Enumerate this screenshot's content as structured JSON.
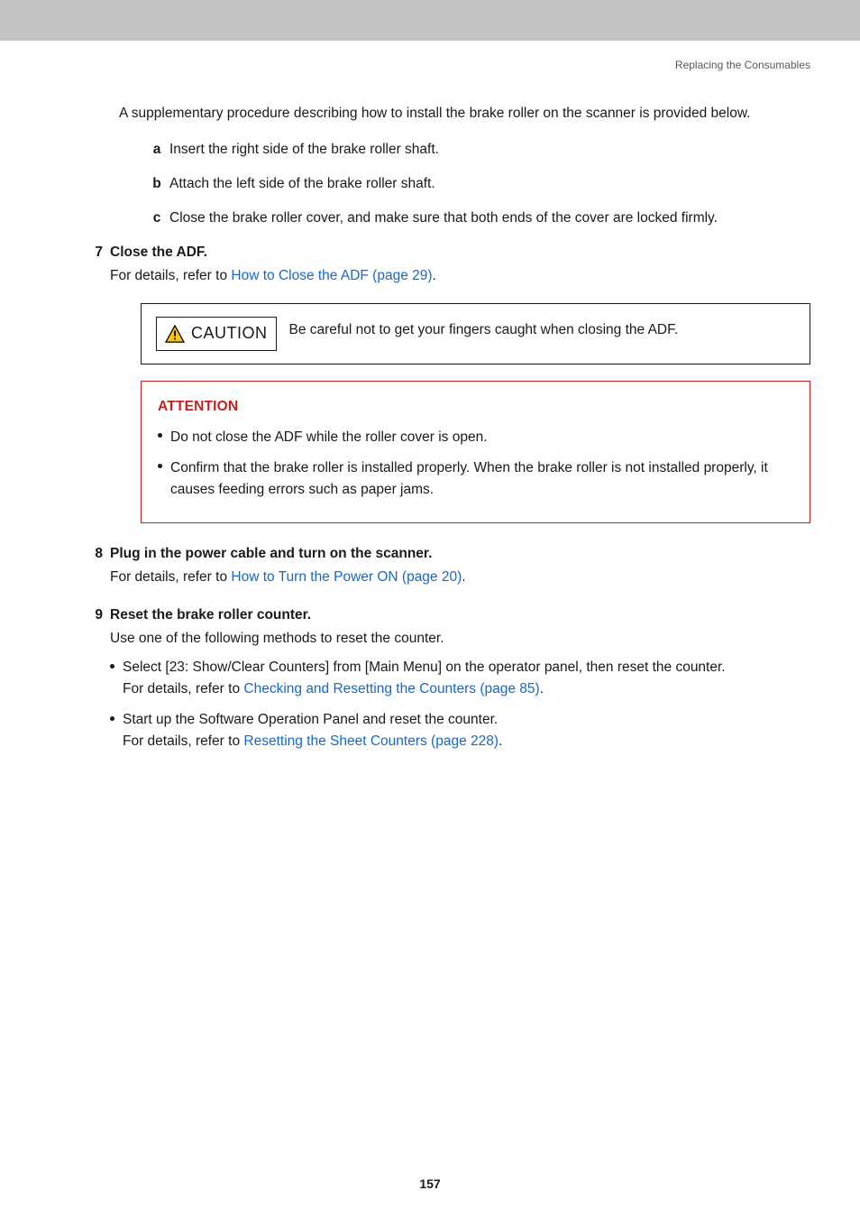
{
  "running_head": "Replacing the Consumables",
  "intro": "A supplementary procedure describing how to install the brake roller on the scanner is provided below.",
  "sub": {
    "a": {
      "m": "a",
      "t": "Insert the right side of the brake roller shaft."
    },
    "b": {
      "m": "b",
      "t": "Attach the left side of the brake roller shaft."
    },
    "c": {
      "m": "c",
      "t": "Close the brake roller cover, and make sure that both ends of the cover are locked firmly."
    }
  },
  "s7": {
    "num": "7",
    "title": "Close the ADF.",
    "lead": "For details, refer to ",
    "link": "How to Close the ADF (page 29)",
    "tail": "."
  },
  "caution": {
    "label": "CAUTION",
    "text": "Be careful not to get your fingers caught when closing the ADF."
  },
  "attention": {
    "title": "ATTENTION",
    "b1": "Do not close the ADF while the roller cover is open.",
    "b2": "Confirm that the brake roller is installed properly. When the brake roller is not installed properly, it causes feeding errors such as paper jams."
  },
  "s8": {
    "num": "8",
    "title": "Plug in the power cable and turn on the scanner.",
    "lead": "For details, refer to ",
    "link": "How to Turn the Power ON (page 20)",
    "tail": "."
  },
  "s9": {
    "num": "9",
    "title": "Reset the brake roller counter.",
    "intro": "Use one of the following methods to reset the counter.",
    "b1a": "Select [23: Show/Clear Counters] from [Main Menu] on the operator panel, then reset the counter.",
    "b1b_lead": "For details, refer to ",
    "b1b_link": "Checking and Resetting the Counters (page 85)",
    "b1b_tail": ".",
    "b2a": "Start up the Software Operation Panel and reset the counter.",
    "b2b_lead": "For details, refer to ",
    "b2b_link": "Resetting the Sheet Counters (page 228)",
    "b2b_tail": "."
  },
  "page_number": "157"
}
